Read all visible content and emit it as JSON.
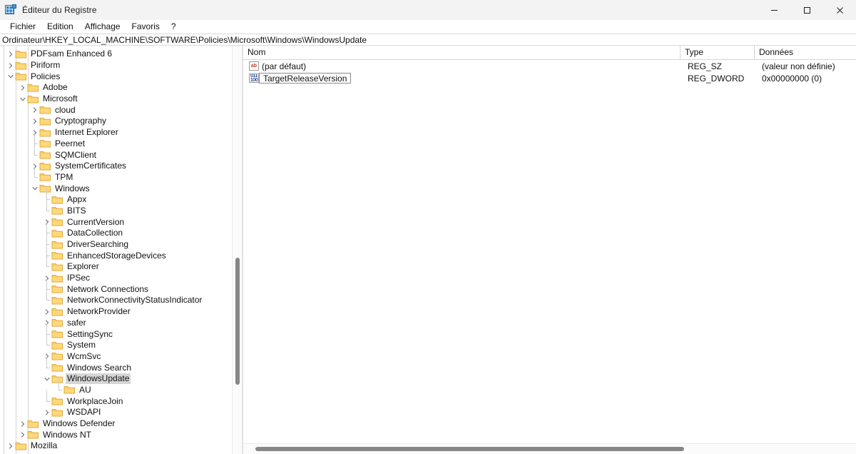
{
  "window": {
    "title": "Éditeur du Registre",
    "icon": "registry-editor-icon",
    "controls": {
      "minimize": "—",
      "maximize": "▢",
      "close": "✕"
    }
  },
  "menu": {
    "items": [
      {
        "label": "Fichier"
      },
      {
        "label": "Edition"
      },
      {
        "label": "Affichage"
      },
      {
        "label": "Favoris"
      },
      {
        "label": "?"
      }
    ]
  },
  "address": {
    "path": "Ordinateur\\HKEY_LOCAL_MACHINE\\SOFTWARE\\Policies\\Microsoft\\Windows\\WindowsUpdate"
  },
  "tree": {
    "nodes": [
      {
        "label": "PDFsam Enhanced 6",
        "depth": 1,
        "state": "collapsed"
      },
      {
        "label": "Piriform",
        "depth": 1,
        "state": "collapsed"
      },
      {
        "label": "Policies",
        "depth": 1,
        "state": "expanded"
      },
      {
        "label": "Adobe",
        "depth": 2,
        "state": "collapsed"
      },
      {
        "label": "Microsoft",
        "depth": 2,
        "state": "expanded"
      },
      {
        "label": "cloud",
        "depth": 3,
        "state": "collapsed"
      },
      {
        "label": "Cryptography",
        "depth": 3,
        "state": "collapsed"
      },
      {
        "label": "Internet Explorer",
        "depth": 3,
        "state": "collapsed"
      },
      {
        "label": "Peernet",
        "depth": 3,
        "state": "leaf"
      },
      {
        "label": "SQMClient",
        "depth": 3,
        "state": "leaf"
      },
      {
        "label": "SystemCertificates",
        "depth": 3,
        "state": "collapsed"
      },
      {
        "label": "TPM",
        "depth": 3,
        "state": "leaf"
      },
      {
        "label": "Windows",
        "depth": 3,
        "state": "expanded"
      },
      {
        "label": "Appx",
        "depth": 4,
        "state": "leaf"
      },
      {
        "label": "BITS",
        "depth": 4,
        "state": "leaf"
      },
      {
        "label": "CurrentVersion",
        "depth": 4,
        "state": "collapsed"
      },
      {
        "label": "DataCollection",
        "depth": 4,
        "state": "leaf"
      },
      {
        "label": "DriverSearching",
        "depth": 4,
        "state": "leaf"
      },
      {
        "label": "EnhancedStorageDevices",
        "depth": 4,
        "state": "leaf"
      },
      {
        "label": "Explorer",
        "depth": 4,
        "state": "leaf"
      },
      {
        "label": "IPSec",
        "depth": 4,
        "state": "collapsed"
      },
      {
        "label": "Network Connections",
        "depth": 4,
        "state": "leaf"
      },
      {
        "label": "NetworkConnectivityStatusIndicator",
        "depth": 4,
        "state": "leaf"
      },
      {
        "label": "NetworkProvider",
        "depth": 4,
        "state": "collapsed"
      },
      {
        "label": "safer",
        "depth": 4,
        "state": "collapsed"
      },
      {
        "label": "SettingSync",
        "depth": 4,
        "state": "leaf"
      },
      {
        "label": "System",
        "depth": 4,
        "state": "leaf"
      },
      {
        "label": "WcmSvc",
        "depth": 4,
        "state": "collapsed"
      },
      {
        "label": "Windows Search",
        "depth": 4,
        "state": "leaf"
      },
      {
        "label": "WindowsUpdate",
        "depth": 4,
        "state": "expanded",
        "selected": true
      },
      {
        "label": "AU",
        "depth": 5,
        "state": "leaf"
      },
      {
        "label": "WorkplaceJoin",
        "depth": 4,
        "state": "leaf"
      },
      {
        "label": "WSDAPI",
        "depth": 4,
        "state": "collapsed"
      },
      {
        "label": "Windows Defender",
        "depth": 2,
        "state": "collapsed"
      },
      {
        "label": "Windows NT",
        "depth": 2,
        "state": "collapsed"
      },
      {
        "label": "Mozilla",
        "depth": 1,
        "state": "collapsed"
      }
    ]
  },
  "values": {
    "columns": [
      {
        "label": "Nom"
      },
      {
        "label": "Type"
      },
      {
        "label": "Données"
      }
    ],
    "rows": [
      {
        "name": "(par défaut)",
        "type": "REG_SZ",
        "data": "(valeur non définie)",
        "icon": "string-value-icon",
        "editing": false
      },
      {
        "name": "TargetReleaseVersion",
        "type": "REG_DWORD",
        "data": "0x00000000 (0)",
        "icon": "dword-value-icon",
        "editing": true
      }
    ]
  },
  "scrollbars": {
    "tree_vertical": {
      "top_pct": 52,
      "height_pct": 31
    },
    "list_horizontal": {
      "left_pct": 2,
      "width_pct": 70
    }
  },
  "colors": {
    "folder": "#ffd87a",
    "folder_edge": "#e0aa3e",
    "selection": "#d6d6d6",
    "titlebar": "#f3f3f3",
    "scroll_thumb": "#878787"
  }
}
